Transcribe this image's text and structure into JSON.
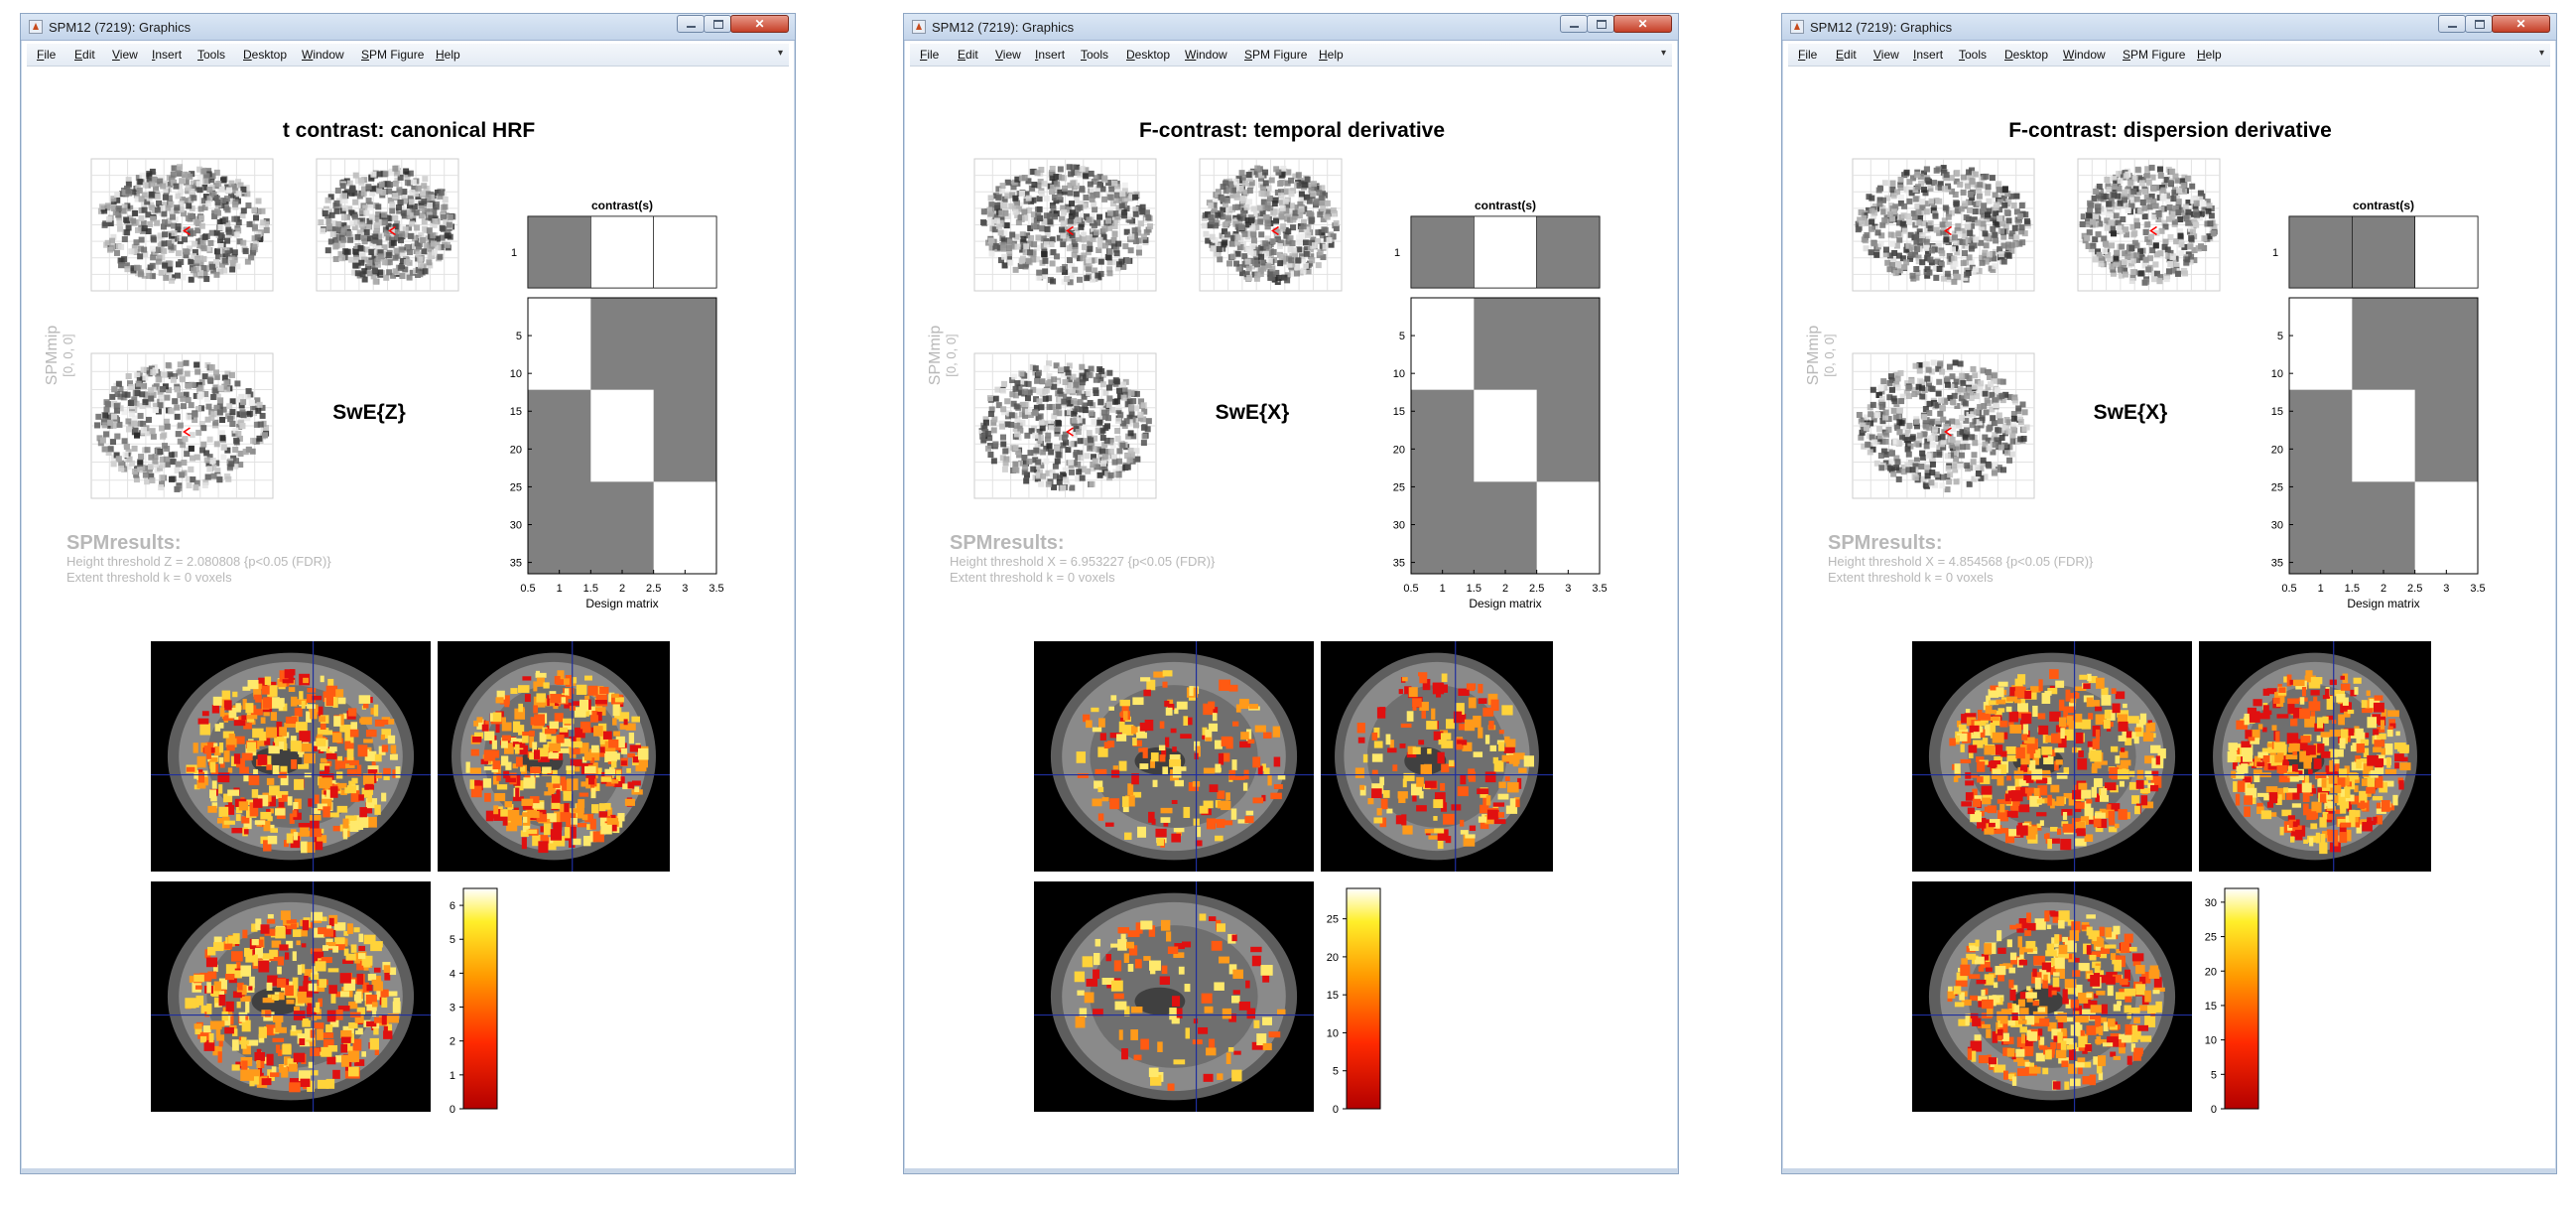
{
  "menu": [
    "File",
    "Edit",
    "View",
    "Insert",
    "Tools",
    "Desktop",
    "Window",
    "SPM Figure",
    "Help"
  ],
  "glass_axis_labels": [
    "1",
    "5",
    "10",
    "15",
    "20",
    "25",
    "30",
    "35"
  ],
  "contrast_title": "contrast(s)",
  "design_label": "Design matrix",
  "x_ticks": [
    "0.5",
    "1",
    "1.5",
    "2",
    "2.5",
    "3",
    "3.5"
  ],
  "spm_mip_label": "SPMmip",
  "coord_label": "[0, 0, 0]",
  "results_title": "SPMresults:",
  "extent_text": "Extent threshold k = 0 voxels",
  "colors": {
    "accent": "#ff0000",
    "grey": "#808080",
    "crosshair": "#1f2f9e",
    "text_faint": "#b8b8b8"
  },
  "icons": [
    "spm-app-icon",
    "minimize-icon",
    "maximize-icon",
    "close-icon",
    "menu-overflow-icon"
  ],
  "windows": [
    {
      "title": "SPM12 (7219): Graphics",
      "fig_title": "t contrast: canonical HRF",
      "stat_label": "SwE{Z}",
      "height_text": "Height threshold Z = 2.080808  {p<0.05 (FDR)}",
      "contrast_weights": [
        1,
        0,
        0
      ],
      "colorbar_ticks": [
        "0",
        "1",
        "2",
        "3",
        "4",
        "5",
        "6"
      ],
      "colorbar_max": 6.5
    },
    {
      "title": "SPM12 (7219): Graphics",
      "fig_title": "F-contrast: temporal derivative",
      "stat_label": "SwE{X}",
      "height_text": "Height threshold X = 6.953227  {p<0.05 (FDR)}",
      "contrast_weights": [
        1,
        0,
        1
      ],
      "colorbar_ticks": [
        "0",
        "5",
        "10",
        "15",
        "20",
        "25"
      ],
      "colorbar_max": 29
    },
    {
      "title": "SPM12 (7219): Graphics",
      "fig_title": "F-contrast: dispersion derivative",
      "stat_label": "SwE{X}",
      "height_text": "Height threshold X = 4.854568  {p<0.05 (FDR)}",
      "contrast_weights": [
        1,
        1,
        0
      ],
      "colorbar_ticks": [
        "0",
        "5",
        "10",
        "15",
        "20",
        "25",
        "30"
      ],
      "colorbar_max": 32
    }
  ]
}
